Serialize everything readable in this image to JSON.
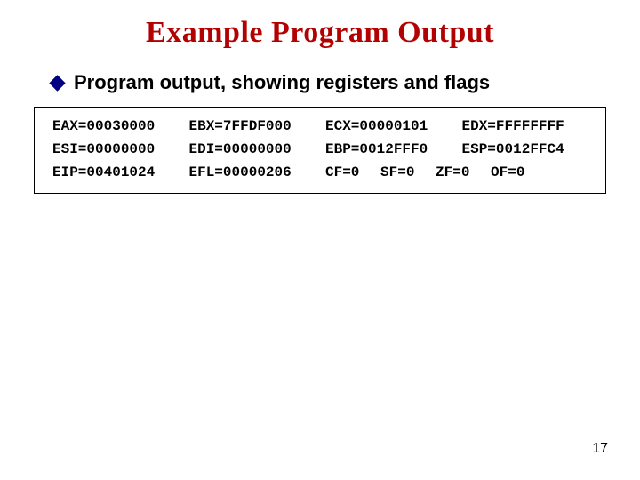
{
  "title": "Example Program Output",
  "bullet": "Program output, showing registers and flags",
  "registers": {
    "row1": {
      "c1": "EAX=00030000",
      "c2": "EBX=7FFDF000",
      "c3": "ECX=00000101",
      "c4": "EDX=FFFFFFFF"
    },
    "row2": {
      "c1": "ESI=00000000",
      "c2": "EDI=00000000",
      "c3": "EBP=0012FFF0",
      "c4": "ESP=0012FFC4"
    },
    "row3": {
      "c1": "EIP=00401024",
      "c2": "EFL=00000206"
    }
  },
  "flags": {
    "cf": "CF=0",
    "sf": "SF=0",
    "zf": "ZF=0",
    "of": "OF=0"
  },
  "page_number": "17"
}
